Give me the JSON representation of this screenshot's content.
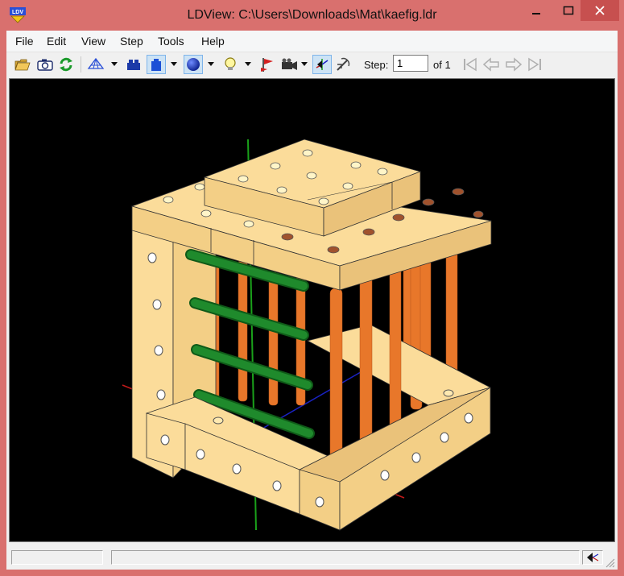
{
  "window": {
    "title": "LDView: C:\\Users\\Downloads\\Mat\\kaefig.ldr",
    "app_icon_text": "LDV"
  },
  "menu": [
    {
      "label": "File"
    },
    {
      "label": "Edit"
    },
    {
      "label": "View"
    },
    {
      "label": "Step"
    },
    {
      "label": "Tools"
    },
    {
      "label": "Help"
    }
  ],
  "toolbar": {
    "buttons": [
      {
        "name": "open-folder-icon"
      },
      {
        "name": "camera-snapshot-icon"
      },
      {
        "name": "reload-icon"
      },
      {
        "name": "wireframe-icon"
      },
      {
        "name": "stud-icon"
      },
      {
        "name": "blue-brick-icon"
      },
      {
        "name": "blue-sphere-icon"
      },
      {
        "name": "lightbulb-icon"
      },
      {
        "name": "flag-icon"
      },
      {
        "name": "video-camera-icon"
      },
      {
        "name": "axes-icon"
      },
      {
        "name": "examine-mode-icon"
      },
      {
        "name": "first-step-icon"
      },
      {
        "name": "previous-step-icon"
      },
      {
        "name": "next-step-icon"
      },
      {
        "name": "last-step-icon"
      }
    ],
    "step_label": "Step:",
    "step_value": "1",
    "step_total": "of 1"
  },
  "colors": {
    "brick": "#fbdc9a",
    "brick_side": "#eac27a",
    "rod_orange": "#e8772a",
    "rod_green": "#1f8a2c",
    "axis_red": "#c21a1a",
    "axis_green": "#1aa11a",
    "axis_blue": "#1a22c2",
    "viewport_bg": "#000000"
  },
  "statusbar": {
    "panes": [
      "",
      ""
    ],
    "axes_icon": "axes-icon"
  }
}
